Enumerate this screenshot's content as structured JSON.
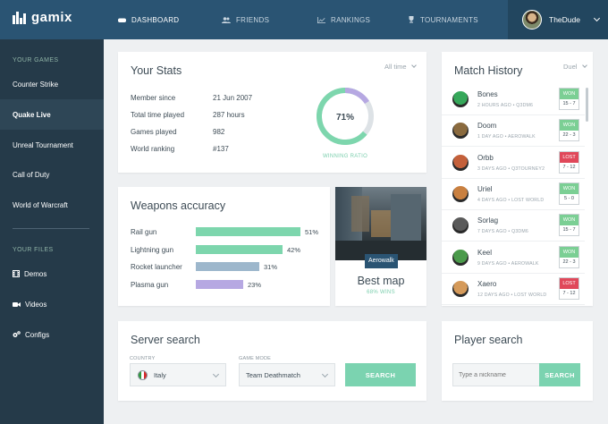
{
  "brand": "gamix",
  "nav": [
    {
      "label": "DASHBOARD",
      "icon": "gamepad-icon"
    },
    {
      "label": "FRIENDS",
      "icon": "users-icon"
    },
    {
      "label": "RANKINGS",
      "icon": "chart-icon"
    },
    {
      "label": "TOURNAMENTS",
      "icon": "trophy-icon"
    }
  ],
  "user": {
    "name": "TheDude"
  },
  "sidebar": {
    "games_heading": "YOUR GAMES",
    "games": [
      "Counter Strike",
      "Quake Live",
      "Unreal Tournament",
      "Call of Duty",
      "World of Warcraft"
    ],
    "active_game": "Quake Live",
    "files_heading": "YOUR FILES",
    "files": [
      {
        "label": "Demos",
        "icon": "film-icon"
      },
      {
        "label": "Videos",
        "icon": "video-camera-icon"
      },
      {
        "label": "Configs",
        "icon": "cogs-icon"
      }
    ]
  },
  "stats": {
    "title": "Your Stats",
    "filter": "All time",
    "rows": [
      {
        "label": "Member since",
        "value": "21 Jun 2007"
      },
      {
        "label": "Total time played",
        "value": "287 hours"
      },
      {
        "label": "Games played",
        "value": "982"
      },
      {
        "label": "World ranking",
        "value": "#137"
      }
    ],
    "ratio": {
      "value": 0.71,
      "text": "71%",
      "label": "WINNING RATIO"
    }
  },
  "weapons": {
    "title": "Weapons accuracy",
    "items": [
      {
        "name": "Rail gun",
        "pct": 51,
        "text": "51%",
        "color": "#7dd6ad"
      },
      {
        "name": "Lightning gun",
        "pct": 42,
        "text": "42%",
        "color": "#7dd6ad"
      },
      {
        "name": "Rocket launcher",
        "pct": 31,
        "text": "31%",
        "color": "#9db7cc"
      },
      {
        "name": "Plasma gun",
        "pct": 23,
        "text": "23%",
        "color": "#b6a8e2"
      }
    ]
  },
  "bestmap": {
    "map": "Aerowalk",
    "title": "Best map",
    "wins": "68% WINS"
  },
  "history": {
    "title": "Match History",
    "filter": "Duel",
    "matches": [
      {
        "name": "Bones",
        "time": "2 HOURS AGO",
        "map": "Q3DM6",
        "result": "WON",
        "score": "15 - 7",
        "color": "#36a85a"
      },
      {
        "name": "Doom",
        "time": "1 DAY AGO",
        "map": "AEROWALK",
        "result": "WON",
        "score": "22 - 3",
        "color": "#8a6a3e"
      },
      {
        "name": "Orbb",
        "time": "3 DAYS AGO",
        "map": "Q3TOURNEY2",
        "result": "LOST",
        "score": "7 - 12",
        "color": "#c4603a"
      },
      {
        "name": "Uriel",
        "time": "4 DAYS AGO",
        "map": "LOST WORLD",
        "result": "WON",
        "score": "5 - 0",
        "color": "#c98040"
      },
      {
        "name": "Sorlag",
        "time": "7 DAYS AGO",
        "map": "Q3DM6",
        "result": "WON",
        "score": "15 - 7",
        "color": "#5a5a5a"
      },
      {
        "name": "Keel",
        "time": "9 DAYS AGO",
        "map": "AEROWALK",
        "result": "WON",
        "score": "22 - 3",
        "color": "#4a9a4a"
      },
      {
        "name": "Xaero",
        "time": "12 DAYS AGO",
        "map": "LOST WORLD",
        "result": "LOST",
        "score": "7 - 12",
        "color": "#d59a5a"
      }
    ],
    "won_color": "#7bcf94",
    "lost_color": "#e0485a"
  },
  "server": {
    "title": "Server search",
    "country_label": "COUNTRY",
    "country": "Italy",
    "mode_label": "GAME MODE",
    "mode": "Team Deathmatch",
    "button": "SEARCH"
  },
  "player": {
    "title": "Player search",
    "placeholder": "Type a nickname",
    "button": "SEARCH"
  }
}
